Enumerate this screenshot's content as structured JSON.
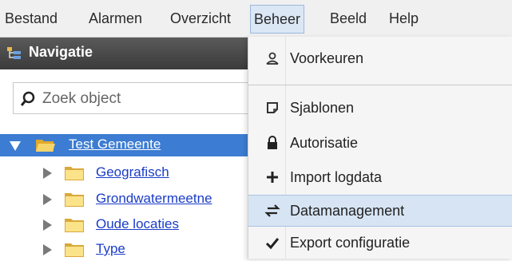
{
  "menubar": {
    "items": [
      "Bestand",
      "Alarmen",
      "Overzicht",
      "Beheer",
      "Beeld",
      "Help"
    ],
    "active": "Beheer"
  },
  "navigation": {
    "title": "Navigatie",
    "search_placeholder": "Zoek object",
    "tree": {
      "root": "Test Gemeente",
      "children": [
        "Geografisch",
        "Grondwatermeetne",
        "Oude locaties",
        "Type"
      ]
    }
  },
  "dropdown": {
    "items": [
      {
        "label": "Voorkeuren",
        "icon": "user-icon"
      },
      {
        "label": "Sjablonen",
        "icon": "template-icon"
      },
      {
        "label": "Autorisatie",
        "icon": "lock-icon"
      },
      {
        "label": "Import logdata",
        "icon": "plus-icon"
      },
      {
        "label": "Datamanagement",
        "icon": "swap-arrows-icon"
      },
      {
        "label": "Export configuratie",
        "icon": "checkmark-icon"
      }
    ],
    "highlighted": "Datamanagement"
  },
  "colors": {
    "selection": "#3c7cd2",
    "menu_active": "#dbe7f5",
    "link": "#1a3cc8",
    "folder": "#f2c94c"
  }
}
